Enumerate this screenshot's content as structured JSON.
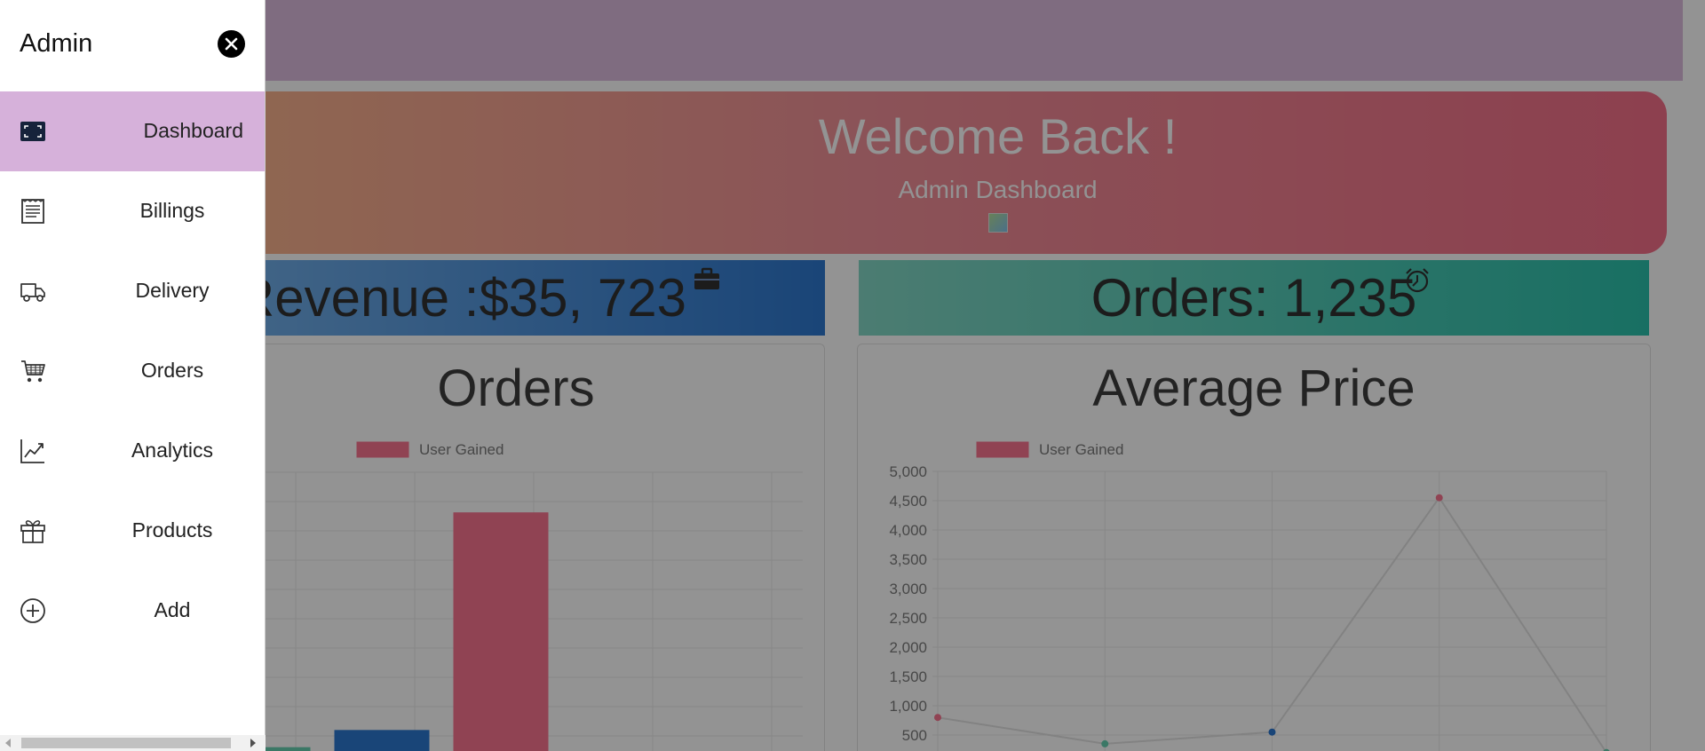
{
  "sidebar": {
    "title": "Admin",
    "items": [
      {
        "label": "Dashboard",
        "icon": "dashboard-icon",
        "active": true
      },
      {
        "label": "Billings",
        "icon": "receipt-icon"
      },
      {
        "label": "Delivery",
        "icon": "truck-icon"
      },
      {
        "label": "Orders",
        "icon": "cart-icon"
      },
      {
        "label": "Analytics",
        "icon": "chart-line-icon"
      },
      {
        "label": "Products",
        "icon": "gift-icon"
      },
      {
        "label": "Add",
        "icon": "plus-circle-icon"
      }
    ]
  },
  "header": {
    "welcome": "Welcome Back !",
    "subtitle": "Admin Dashboard"
  },
  "stats": {
    "revenue": "Revenue :$35, 723",
    "revenue_icon": "briefcase-icon",
    "orders": "Orders: 1,235",
    "orders_icon": "alarm-clock-icon"
  },
  "colors": {
    "accent": "#d6b1da",
    "bar_red": "#f95f7f",
    "bar_blue": "#0a62c8",
    "bar_green": "#4fc8a4"
  },
  "chart_data": [
    {
      "type": "bar",
      "title": "Orders",
      "legend": "User Gained",
      "categories": [
        "",
        "",
        "",
        "",
        ""
      ],
      "values": [
        400,
        700,
        4500,
        100,
        0
      ],
      "ylim": [
        0,
        5000
      ],
      "grid": true,
      "legend_position": "top"
    },
    {
      "type": "line",
      "title": "Average Price",
      "legend": "User Gained",
      "categories": [
        "",
        "",
        "",
        "",
        ""
      ],
      "values": [
        800,
        350,
        550,
        4550,
        200
      ],
      "yticks": [
        "5,000",
        "4,500",
        "4,000",
        "3,500",
        "3,000",
        "2,500",
        "2,000",
        "1,500",
        "1,000",
        "500"
      ],
      "ylim": [
        0,
        5000
      ],
      "grid": true,
      "legend_position": "top"
    }
  ]
}
